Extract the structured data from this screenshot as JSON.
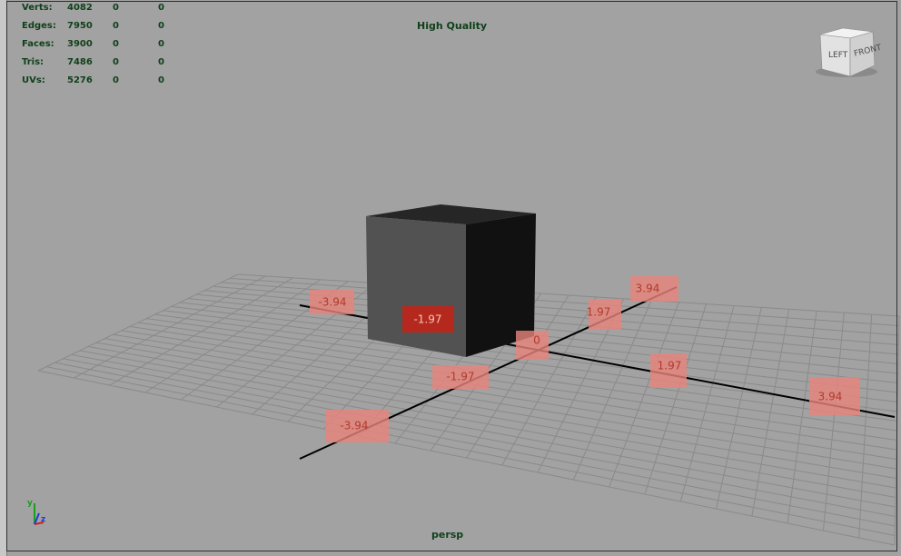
{
  "stats": [
    {
      "label": "Verts:",
      "values": [
        "4082",
        "0",
        "0"
      ]
    },
    {
      "label": "Edges:",
      "values": [
        "7950",
        "0",
        "0"
      ]
    },
    {
      "label": "Faces:",
      "values": [
        "3900",
        "0",
        "0"
      ]
    },
    {
      "label": "Tris:",
      "values": [
        "7486",
        "0",
        "0"
      ]
    },
    {
      "label": "UVs:",
      "values": [
        "5276",
        "0",
        "0"
      ]
    }
  ],
  "viewport": {
    "quality_label": "High Quality",
    "camera_name": "persp"
  },
  "view_cube": {
    "left_face": "LEFT",
    "front_face": "FRONT"
  },
  "axis_gizmo": {
    "y": "y",
    "z": "z",
    "x": "x"
  },
  "measure_labels": {
    "z_neg_far": "-3.94",
    "z_neg_near": "-1.97",
    "x_neg_near": "-1.97",
    "x_neg_far": "-3.94",
    "origin": "0",
    "x_pos_near": "1.97",
    "x_pos_far": "3.94",
    "z_pos_near": "1.97",
    "z_pos_far": "3.94"
  },
  "colors": {
    "viewport_bg": "#a2a2a2",
    "hud_text": "#0f3f1a",
    "label_box": "#e8857a",
    "label_box_selected": "#b5281e",
    "grid_line": "#8a8a8a",
    "axis_line": "#000000"
  }
}
